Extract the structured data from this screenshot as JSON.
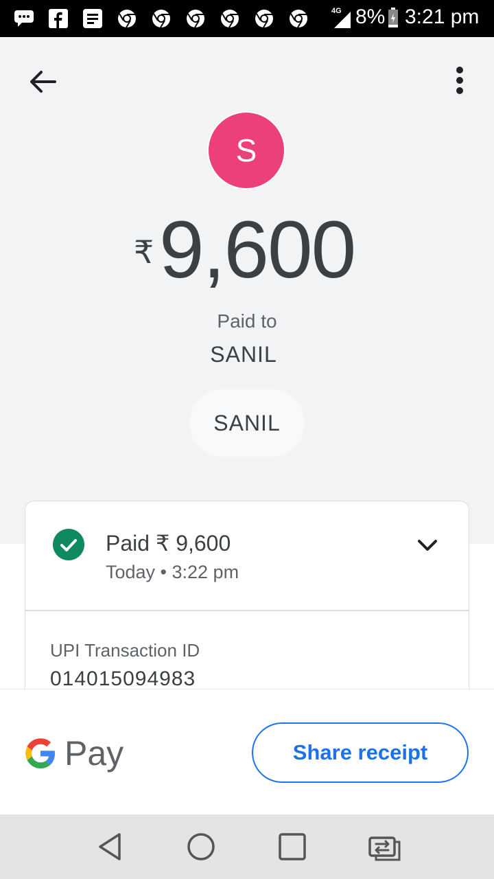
{
  "status_bar": {
    "network": "4G",
    "battery": "8%",
    "time": "3:21 pm",
    "notification_icons": [
      "message-icon",
      "facebook-icon",
      "news-icon",
      "chrome-icon",
      "chrome-icon",
      "chrome-icon",
      "chrome-icon",
      "chrome-icon",
      "chrome-icon"
    ]
  },
  "header": {
    "back_icon": "arrow-back-icon",
    "more_icon": "more-vert-icon"
  },
  "payment": {
    "avatar_initial": "S",
    "currency_symbol": "₹",
    "amount": "9,600",
    "paid_to_label": "Paid to",
    "payee_name": "SANIL",
    "payee_chip": "SANIL"
  },
  "card": {
    "status_title": "Paid ₹ 9,600",
    "status_time": "Today • 3:22 pm",
    "upi_label": "UPI Transaction ID",
    "upi_value": "014015094983"
  },
  "footer": {
    "brand_text": "Pay",
    "share_label": "Share receipt"
  },
  "colors": {
    "avatar": "#ec407a",
    "success": "#0f8a5f",
    "accent": "#1a73e8"
  }
}
